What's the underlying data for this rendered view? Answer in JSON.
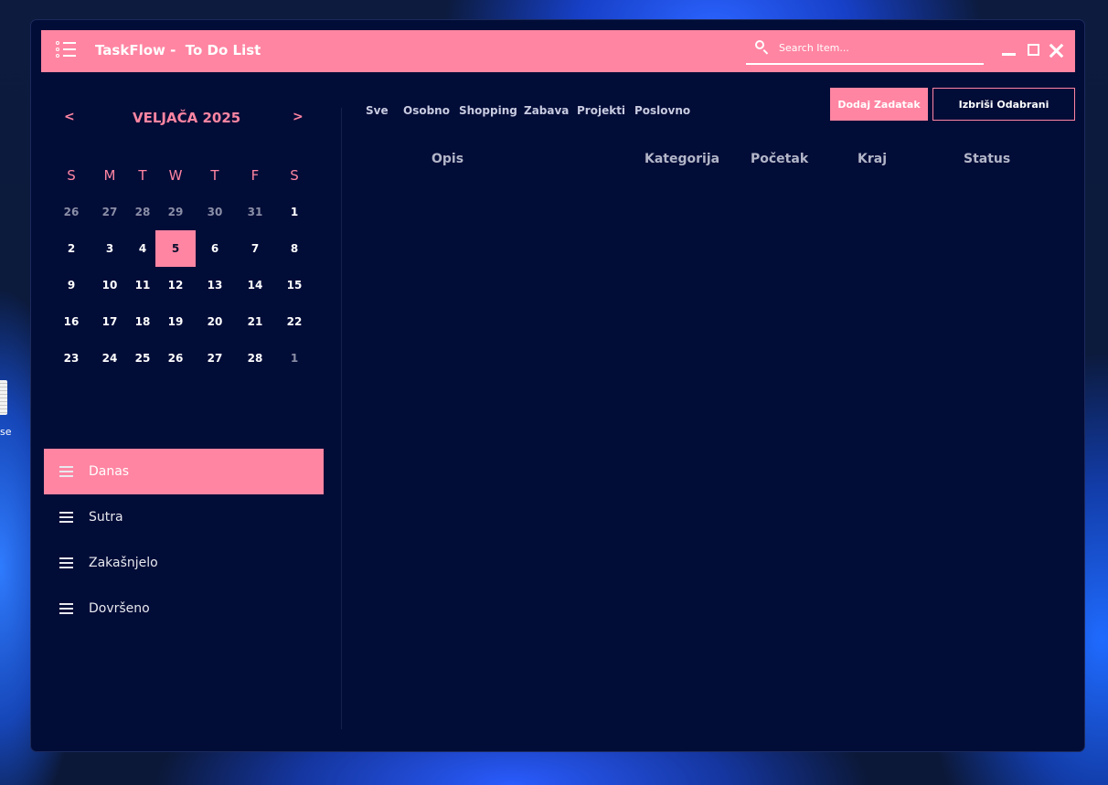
{
  "desktop": {
    "icon_label": "se"
  },
  "app": {
    "title": "TaskFlow -  To Do List",
    "accent_color": "#ff85a2",
    "background_color": "#010c37",
    "icon": "checklist-icon"
  },
  "search": {
    "placeholder": "Search Item...",
    "value": "",
    "icon": "search-icon"
  },
  "window_controls": [
    "minimize-icon",
    "maximize-icon",
    "close-icon"
  ],
  "calendar": {
    "prev": "<",
    "next": ">",
    "month_label": "VELJAČA 2025",
    "weekdays": [
      "S",
      "M",
      "T",
      "W",
      "T",
      "F",
      "S"
    ],
    "weeks": [
      [
        "26",
        "27",
        "28",
        "29",
        "30",
        "31",
        "1"
      ],
      [
        "2",
        "3",
        "4",
        "5",
        "6",
        "7",
        "8"
      ],
      [
        "9",
        "10",
        "11",
        "12",
        "13",
        "14",
        "15"
      ],
      [
        "16",
        "17",
        "18",
        "19",
        "20",
        "21",
        "22"
      ],
      [
        "23",
        "24",
        "25",
        "26",
        "27",
        "28",
        "1"
      ]
    ],
    "selected_day": "5"
  },
  "nav": {
    "items": [
      {
        "label": "Danas",
        "active": true
      },
      {
        "label": "Sutra",
        "active": false
      },
      {
        "label": "Zakašnjelo",
        "active": false
      },
      {
        "label": "Dovršeno",
        "active": false
      }
    ]
  },
  "tabs": [
    "Sve",
    "Osobno",
    "Shopping",
    "Zabava",
    "Projekti",
    "Poslovno"
  ],
  "actions": {
    "add_label": "Dodaj Zadatak",
    "delete_label": "Izbriši Odabrani"
  },
  "table": {
    "columns": [
      "Opis",
      "Kategorija",
      "Početak",
      "Kraj",
      "Status"
    ],
    "rows": []
  }
}
